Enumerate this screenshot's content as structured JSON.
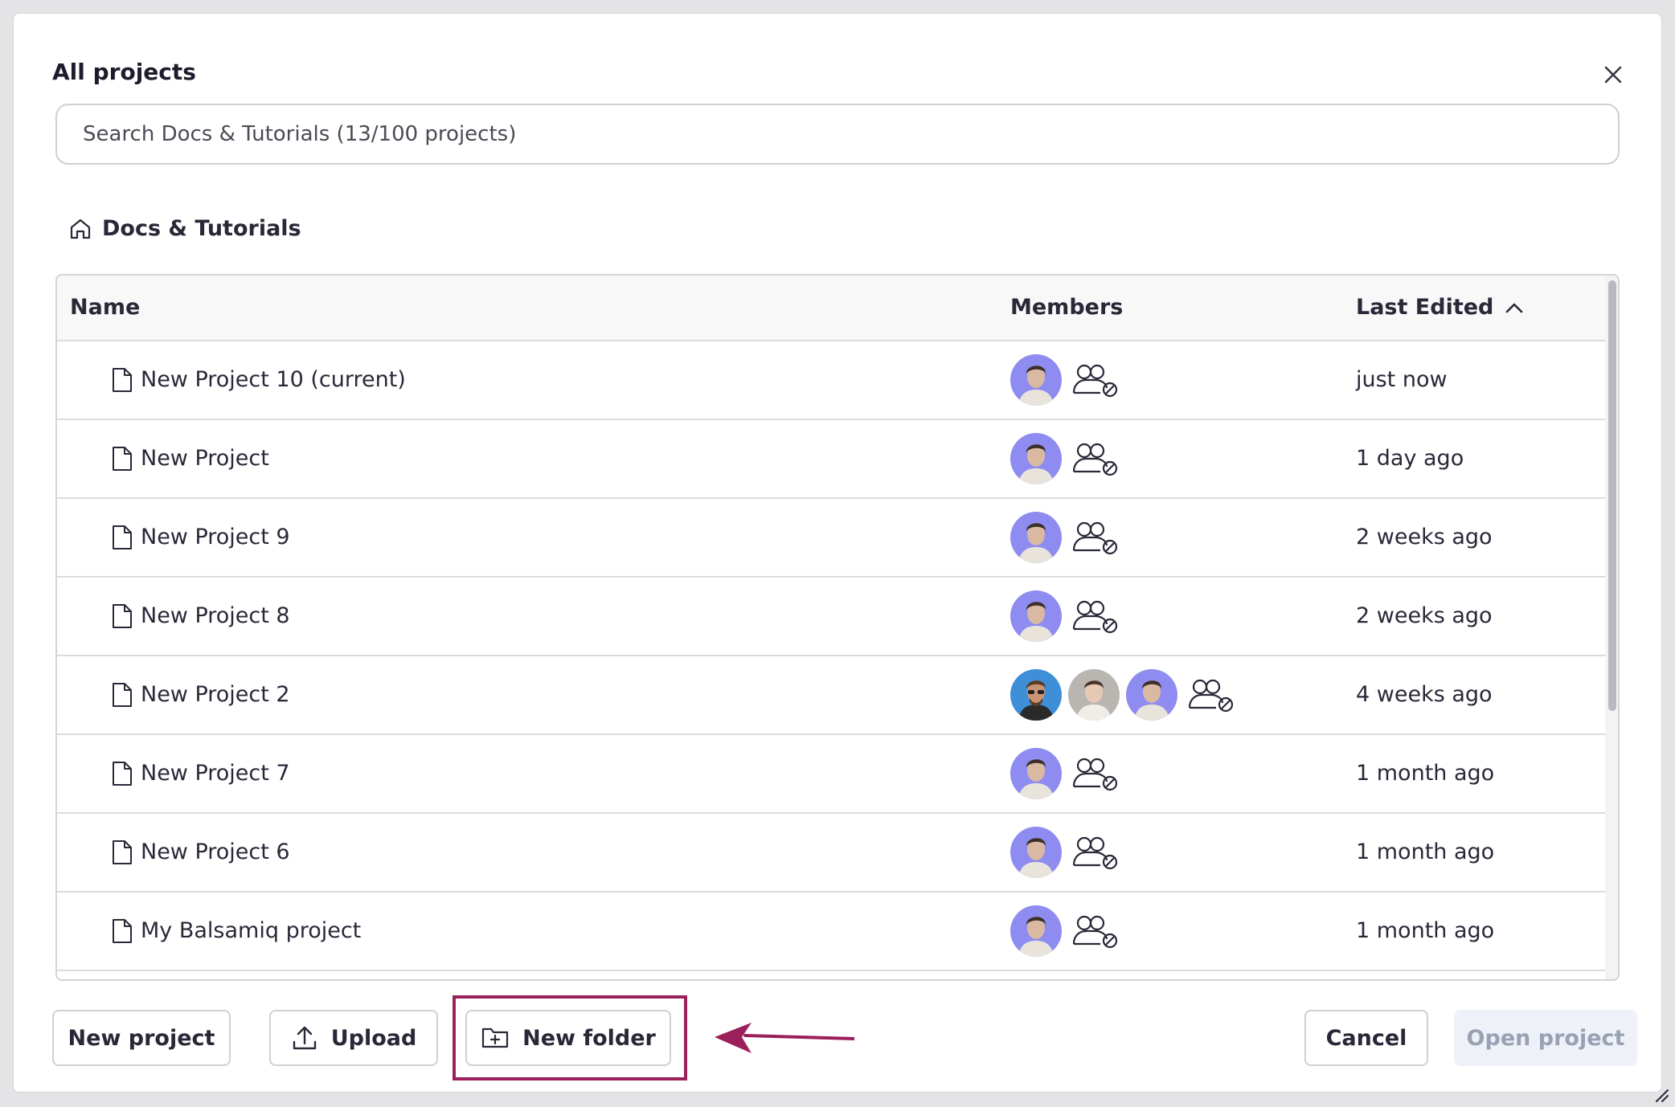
{
  "dialog": {
    "title": "All projects",
    "search_placeholder": "Search Docs & Tutorials (13/100 projects)",
    "breadcrumb": "Docs & Tutorials"
  },
  "table": {
    "columns": {
      "name": "Name",
      "members": "Members",
      "last_edited": "Last Edited"
    },
    "sort": {
      "column": "last_edited",
      "direction": "ascending-indicator"
    },
    "rows": [
      {
        "name": "New Project 10 (current)",
        "members": [
          "member-a"
        ],
        "last_edited": "just now"
      },
      {
        "name": "New Project",
        "members": [
          "member-a"
        ],
        "last_edited": "1 day ago"
      },
      {
        "name": "New Project 9",
        "members": [
          "member-a"
        ],
        "last_edited": "2 weeks ago"
      },
      {
        "name": "New Project 8",
        "members": [
          "member-a"
        ],
        "last_edited": "2 weeks ago"
      },
      {
        "name": "New Project 2",
        "members": [
          "member-b",
          "member-c",
          "member-a"
        ],
        "last_edited": "4 weeks ago"
      },
      {
        "name": "New Project 7",
        "members": [
          "member-a"
        ],
        "last_edited": "1 month ago"
      },
      {
        "name": "New Project 6",
        "members": [
          "member-a"
        ],
        "last_edited": "1 month ago"
      },
      {
        "name": "My Balsamiq project",
        "members": [
          "member-a"
        ],
        "last_edited": "1 month ago"
      }
    ]
  },
  "footer": {
    "new_project": "New project",
    "upload": "Upload",
    "new_folder": "New folder",
    "cancel": "Cancel",
    "open_project": "Open project"
  },
  "icons": {
    "close": "close-icon",
    "home": "home-icon",
    "sort": "chevron-up-icon",
    "file": "file-icon",
    "no_share": "users-no-share-icon",
    "upload": "upload-icon",
    "folder_plus": "folder-plus-icon"
  },
  "colors": {
    "highlight": "#9b1f5a",
    "avatar_bg": "#8e8cf0",
    "disabled_button_bg": "#eef1f8",
    "disabled_button_text": "#9aa1b3"
  }
}
